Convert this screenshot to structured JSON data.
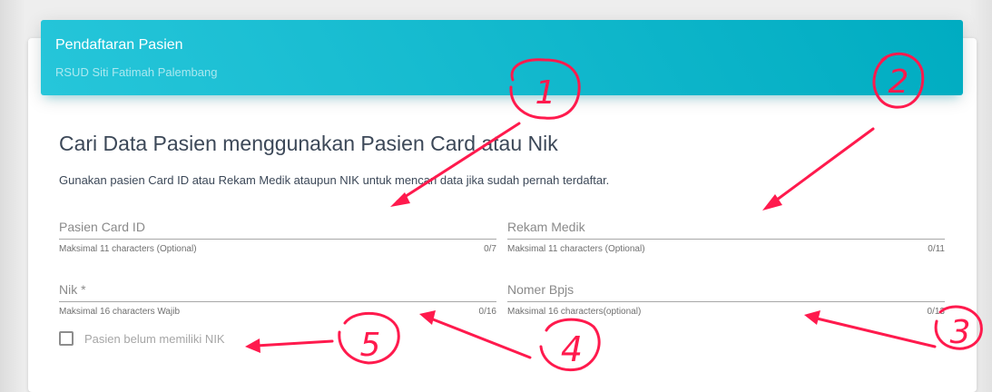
{
  "header": {
    "title": "Pendaftaran Pasien",
    "subtitle": "RSUD Siti Fatimah Palembang"
  },
  "section": {
    "heading": "Cari Data Pasien menggunakan Pasien Card atau Nik",
    "description": "Gunakan pasien Card ID atau Rekam Medik ataupun NIK untuk mencari data jika sudah pernah terdaftar."
  },
  "fields": {
    "pasien_card_id": {
      "label": "Pasien Card ID",
      "hint": "Maksimal 11 characters (Optional)",
      "counter": "0/7"
    },
    "rekam_medik": {
      "label": "Rekam Medik",
      "hint": "Maksimal 11 characters (Optional)",
      "counter": "0/11"
    },
    "nik": {
      "label": "Nik *",
      "hint": "Maksimal 16 characters Wajib",
      "counter": "0/16"
    },
    "nomer_bpjs": {
      "label": "Nomer Bpjs",
      "hint": "Maksimal 16 characters(optional)",
      "counter": "0/13"
    }
  },
  "checkbox": {
    "label": "Pasien belum memiliki NIK",
    "checked": false
  },
  "annotations": {
    "color": "#ff1a4d",
    "numbers": [
      "1",
      "2",
      "3",
      "4",
      "5"
    ]
  }
}
